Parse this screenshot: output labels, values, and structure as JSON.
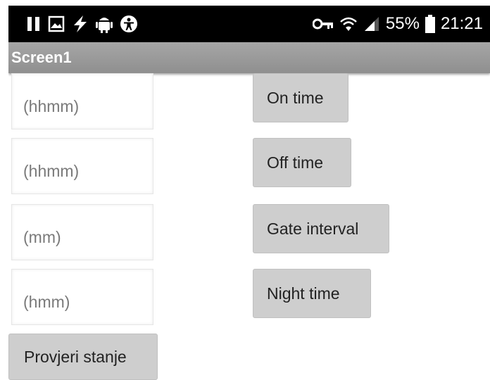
{
  "status_bar": {
    "battery_percent": "55%",
    "time": "21:21",
    "left_icons": [
      "pause-icon",
      "image-icon",
      "bolt-icon",
      "android-icon",
      "accessibility-icon"
    ],
    "right_icons": [
      "key-icon",
      "wifi-icon",
      "signal-icon",
      "battery-icon"
    ]
  },
  "app_bar": {
    "title": "Screen1"
  },
  "inputs": [
    {
      "placeholder": "(hhmm)",
      "value": ""
    },
    {
      "placeholder": "(hhmm)",
      "value": ""
    },
    {
      "placeholder": "(mm)",
      "value": ""
    },
    {
      "placeholder": "(hmm)",
      "value": ""
    }
  ],
  "buttons": {
    "on_time": "On time",
    "off_time": "Off time",
    "gate_interval": "Gate interval",
    "night_time": "Night time",
    "check_status": "Provjeri stanje"
  },
  "colors": {
    "status_bar_bg": "#000000",
    "app_bar_bg": "#9a9a9a",
    "button_bg": "#cecece",
    "page_bg": "#ffffff"
  }
}
